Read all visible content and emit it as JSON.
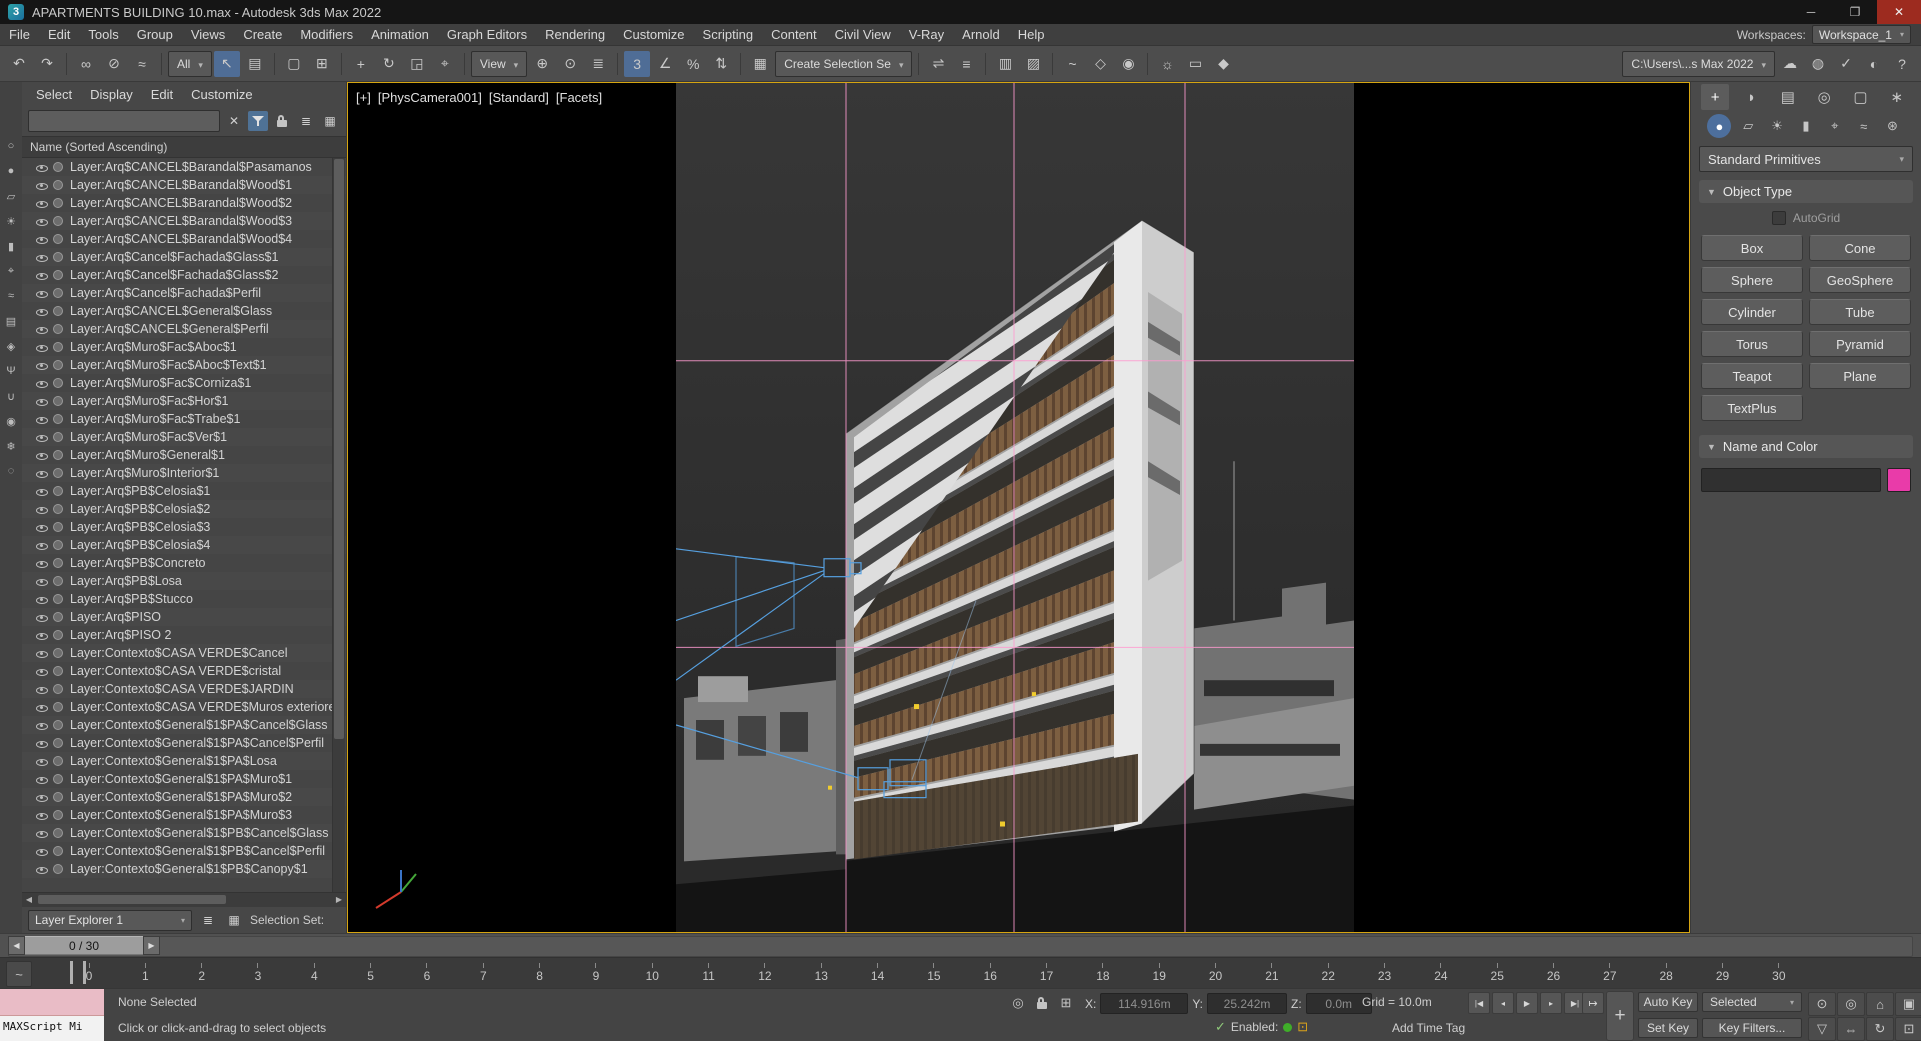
{
  "window": {
    "title": "APARTMENTS BUILDING 10.max - Autodesk 3ds Max 2022",
    "logo": "3",
    "controls": [
      {
        "name": "minimize-button",
        "glyph": "─"
      },
      {
        "name": "maximize-button",
        "glyph": "❐"
      },
      {
        "name": "close-button",
        "glyph": "✕"
      }
    ]
  },
  "menu": {
    "items": [
      "File",
      "Edit",
      "Tools",
      "Group",
      "Views",
      "Create",
      "Modifiers",
      "Animation",
      "Graph Editors",
      "Rendering",
      "Customize",
      "Scripting",
      "Content",
      "Civil View",
      "V-Ray",
      "Arnold",
      "Help"
    ],
    "workspaces_label": "Workspaces:",
    "workspace_value": "Workspace_1"
  },
  "toolbar": {
    "items": [
      {
        "t": "icon",
        "name": "undo-icon",
        "glyph": "↶"
      },
      {
        "t": "icon",
        "name": "redo-icon",
        "glyph": "↷"
      },
      {
        "t": "sep"
      },
      {
        "t": "icon",
        "name": "select-and-link-icon",
        "glyph": "∞"
      },
      {
        "t": "icon",
        "name": "unlink-selection-icon",
        "glyph": "⊘"
      },
      {
        "t": "icon",
        "name": "bind-to-space-warp-icon",
        "glyph": "≈"
      },
      {
        "t": "sep"
      },
      {
        "t": "dd",
        "name": "selection-filter-dropdown",
        "label": "All"
      },
      {
        "t": "icon",
        "name": "select-object-icon",
        "glyph": "↖",
        "active": true
      },
      {
        "t": "icon",
        "name": "select-by-name-icon",
        "glyph": "▤"
      },
      {
        "t": "sep"
      },
      {
        "t": "icon",
        "name": "rectangular-selection-region-icon",
        "glyph": "▢"
      },
      {
        "t": "icon",
        "name": "window-crossing-icon",
        "glyph": "⊞"
      },
      {
        "t": "sep"
      },
      {
        "t": "icon",
        "name": "select-and-move-icon",
        "glyph": "+"
      },
      {
        "t": "icon",
        "name": "select-and-rotate-icon",
        "glyph": "↻"
      },
      {
        "t": "icon",
        "name": "select-and-scale-icon",
        "glyph": "◲"
      },
      {
        "t": "icon",
        "name": "select-and-place-icon",
        "glyph": "⌖"
      },
      {
        "t": "sep"
      },
      {
        "t": "dd",
        "name": "reference-coordinate-dropdown",
        "label": "View"
      },
      {
        "t": "icon",
        "name": "use-pivot-point-center-icon",
        "glyph": "⊕"
      },
      {
        "t": "icon",
        "name": "select-and-manipulate-icon",
        "glyph": "⊙"
      },
      {
        "t": "icon",
        "name": "keyboard-shortcut-override-icon",
        "glyph": "≣"
      },
      {
        "t": "sep"
      },
      {
        "t": "icon",
        "name": "snaps-toggle-icon",
        "glyph": "3",
        "active": true
      },
      {
        "t": "icon",
        "name": "angle-snap-icon",
        "glyph": "∠"
      },
      {
        "t": "icon",
        "name": "percent-snap-icon",
        "glyph": "%"
      },
      {
        "t": "icon",
        "name": "spinner-snap-icon",
        "glyph": "⇅"
      },
      {
        "t": "sep"
      },
      {
        "t": "icon",
        "name": "edit-named-selection-sets-icon",
        "glyph": "▦"
      },
      {
        "t": "dd",
        "name": "named-selection-sets-dropdown",
        "label": "Create Selection Se"
      },
      {
        "t": "sep"
      },
      {
        "t": "icon",
        "name": "mirror-icon",
        "glyph": "⇌"
      },
      {
        "t": "icon",
        "name": "align-icon",
        "glyph": "≡"
      },
      {
        "t": "sep"
      },
      {
        "t": "icon",
        "name": "toggle-scene-explorer-icon",
        "glyph": "▥"
      },
      {
        "t": "icon",
        "name": "toggle-layer-explorer-icon",
        "glyph": "▨"
      },
      {
        "t": "sep"
      },
      {
        "t": "icon",
        "name": "curve-editor-icon",
        "glyph": "~"
      },
      {
        "t": "icon",
        "name": "schematic-view-icon",
        "glyph": "◇"
      },
      {
        "t": "icon",
        "name": "material-editor-icon",
        "glyph": "◉"
      },
      {
        "t": "sep"
      },
      {
        "t": "icon",
        "name": "render-setup-icon",
        "glyph": "☼"
      },
      {
        "t": "icon",
        "name": "rendered-frame-window-icon",
        "glyph": "▭"
      },
      {
        "t": "icon",
        "name": "render-production-icon",
        "glyph": "◆"
      },
      {
        "t": "spacer"
      },
      {
        "t": "dd",
        "name": "project-folder-field",
        "label": "C:\\Users\\...s Max 2022"
      },
      {
        "t": "icon",
        "name": "render-in-cloud-icon",
        "glyph": "☁"
      },
      {
        "t": "icon",
        "name": "autodesk-app-store-icon",
        "glyph": "◍"
      },
      {
        "t": "icon",
        "name": "scene-security-tools-icon",
        "glyph": "✓"
      },
      {
        "t": "icon",
        "name": "autodesk-account-icon",
        "glyph": "◐"
      },
      {
        "t": "icon",
        "name": "help-icon",
        "glyph": "?"
      }
    ]
  },
  "explorer": {
    "menus": [
      "Select",
      "Display",
      "Edit",
      "Customize"
    ],
    "search_value": "",
    "header": "Name (Sorted Ascending)",
    "side_icons": [
      {
        "name": "explorer-find-icon",
        "glyph": "○"
      },
      {
        "name": "display-geometry-icon",
        "glyph": "●"
      },
      {
        "name": "display-shapes-icon",
        "glyph": "▱"
      },
      {
        "name": "display-lights-icon",
        "glyph": "☀"
      },
      {
        "name": "display-cameras-icon",
        "glyph": "▮"
      },
      {
        "name": "display-helpers-icon",
        "glyph": "⌖"
      },
      {
        "name": "display-spacewarps-icon",
        "glyph": "≈"
      },
      {
        "name": "display-groups-icon",
        "glyph": "▤"
      },
      {
        "name": "display-xrefs-icon",
        "glyph": "◈"
      },
      {
        "name": "display-bones-icon",
        "glyph": "Ψ"
      },
      {
        "name": "display-containers-icon",
        "glyph": "∪"
      },
      {
        "name": "display-materials-icon",
        "glyph": "◉"
      },
      {
        "name": "display-frozen-icon",
        "glyph": "❄"
      },
      {
        "name": "display-hidden-icon",
        "glyph": "◌"
      }
    ],
    "layers": [
      "Layer:Arq$CANCEL$Barandal$Pasamanos",
      "Layer:Arq$CANCEL$Barandal$Wood$1",
      "Layer:Arq$CANCEL$Barandal$Wood$2",
      "Layer:Arq$CANCEL$Barandal$Wood$3",
      "Layer:Arq$CANCEL$Barandal$Wood$4",
      "Layer:Arq$Cancel$Fachada$Glass$1",
      "Layer:Arq$Cancel$Fachada$Glass$2",
      "Layer:Arq$Cancel$Fachada$Perfil",
      "Layer:Arq$CANCEL$General$Glass",
      "Layer:Arq$CANCEL$General$Perfil",
      "Layer:Arq$Muro$Fac$Aboc$1",
      "Layer:Arq$Muro$Fac$Aboc$Text$1",
      "Layer:Arq$Muro$Fac$Corniza$1",
      "Layer:Arq$Muro$Fac$Hor$1",
      "Layer:Arq$Muro$Fac$Trabe$1",
      "Layer:Arq$Muro$Fac$Ver$1",
      "Layer:Arq$Muro$General$1",
      "Layer:Arq$Muro$Interior$1",
      "Layer:Arq$PB$Celosia$1",
      "Layer:Arq$PB$Celosia$2",
      "Layer:Arq$PB$Celosia$3",
      "Layer:Arq$PB$Celosia$4",
      "Layer:Arq$PB$Concreto",
      "Layer:Arq$PB$Losa",
      "Layer:Arq$PB$Stucco",
      "Layer:Arq$PISO",
      "Layer:Arq$PISO 2",
      "Layer:Contexto$CASA VERDE$Cancel",
      "Layer:Contexto$CASA VERDE$cristal",
      "Layer:Contexto$CASA VERDE$JARDIN",
      "Layer:Contexto$CASA VERDE$Muros exteriores",
      "Layer:Contexto$General$1$PA$Cancel$Glass",
      "Layer:Contexto$General$1$PA$Cancel$Perfil",
      "Layer:Contexto$General$1$PA$Losa",
      "Layer:Contexto$General$1$PA$Muro$1",
      "Layer:Contexto$General$1$PA$Muro$2",
      "Layer:Contexto$General$1$PA$Muro$3",
      "Layer:Contexto$General$1$PB$Cancel$Glass",
      "Layer:Contexto$General$1$PB$Cancel$Perfil",
      "Layer:Contexto$General$1$PB$Canopy$1"
    ],
    "footer": {
      "explorer_name": "Layer Explorer 1",
      "selection_set_label": "Selection Set:"
    }
  },
  "viewport": {
    "labels": {
      "pov": "[+]",
      "camera": "[PhysCamera001]",
      "style": "[Standard]",
      "shading": "[Facets]"
    }
  },
  "command_panel": {
    "tabs": [
      {
        "name": "create-tab",
        "glyph": "+",
        "active": true
      },
      {
        "name": "modify-tab",
        "glyph": "◗"
      },
      {
        "name": "hierarchy-tab",
        "glyph": "▤"
      },
      {
        "name": "motion-tab",
        "glyph": "◎"
      },
      {
        "name": "display-tab",
        "glyph": "▢"
      },
      {
        "name": "utilities-tab",
        "glyph": "∗"
      }
    ],
    "categories": [
      {
        "name": "geometry-category-icon",
        "glyph": "●",
        "active": true
      },
      {
        "name": "shapes-category-icon",
        "glyph": "▱"
      },
      {
        "name": "lights-category-icon",
        "glyph": "☀"
      },
      {
        "name": "cameras-category-icon",
        "glyph": "▮"
      },
      {
        "name": "helpers-category-icon",
        "glyph": "⌖"
      },
      {
        "name": "spacewarps-category-icon",
        "glyph": "≈"
      },
      {
        "name": "systems-category-icon",
        "glyph": "⊛"
      }
    ],
    "subcategory": "Standard Primitives",
    "rollouts": {
      "object_type": "Object Type",
      "name_color": "Name and Color"
    },
    "autogrid_label": "AutoGrid",
    "buttons": [
      {
        "name": "box-button",
        "label": "Box"
      },
      {
        "name": "cone-button",
        "label": "Cone"
      },
      {
        "name": "sphere-button",
        "label": "Sphere"
      },
      {
        "name": "geosphere-button",
        "label": "GeoSphere"
      },
      {
        "name": "cylinder-button",
        "label": "Cylinder"
      },
      {
        "name": "tube-button",
        "label": "Tube"
      },
      {
        "name": "torus-button",
        "label": "Torus"
      },
      {
        "name": "pyramid-button",
        "label": "Pyramid"
      },
      {
        "name": "teapot-button",
        "label": "Teapot"
      },
      {
        "name": "plane-button",
        "label": "Plane"
      },
      {
        "name": "textplus-button",
        "label": "TextPlus"
      }
    ],
    "name_value": "",
    "object_color": "#e93ba9"
  },
  "timeline": {
    "slider_value": "0 / 30",
    "ticks": [
      "0",
      "1",
      "2",
      "3",
      "4",
      "5",
      "6",
      "7",
      "8",
      "9",
      "10",
      "11",
      "12",
      "13",
      "14",
      "15",
      "16",
      "17",
      "18",
      "19",
      "20",
      "21",
      "22",
      "23",
      "24",
      "25",
      "26",
      "27",
      "28",
      "29",
      "30"
    ]
  },
  "status": {
    "listener_text": "MAXScript Mi",
    "selection_status": "None Selected",
    "prompt": "Click or click-and-drag to select objects",
    "coords": {
      "x_label": "X:",
      "x": "114.916m",
      "y_label": "Y:",
      "y": "25.242m",
      "z_label": "Z:",
      "z": "0.0m"
    },
    "grid": "Grid = 10.0m",
    "security_label": "Enabled:",
    "add_time_tag": "Add Time Tag",
    "auto_key": "Auto Key",
    "set_key": "Set Key",
    "selected": "Selected",
    "key_filters": "Key Filters...",
    "playback": [
      {
        "name": "go-to-start-button",
        "glyph": "|◀"
      },
      {
        "name": "previous-frame-button",
        "glyph": "◂"
      },
      {
        "name": "play-button",
        "glyph": "▶"
      },
      {
        "name": "next-frame-button",
        "glyph": "▸"
      },
      {
        "name": "go-to-end-button",
        "glyph": "▶|"
      }
    ],
    "nav_row1": [
      {
        "name": "zoom-button",
        "glyph": "⊙"
      },
      {
        "name": "zoom-all-button",
        "glyph": "◎"
      },
      {
        "name": "zoom-extents-button",
        "glyph": "⌂"
      },
      {
        "name": "zoom-extents-all-button",
        "glyph": "▣"
      }
    ],
    "nav_row2": [
      {
        "name": "field-of-view-button",
        "glyph": "▽"
      },
      {
        "name": "pan-button",
        "glyph": "⇔"
      },
      {
        "name": "orbit-button",
        "glyph": "↻"
      },
      {
        "name": "maximize-viewport-button",
        "glyph": "⊡"
      }
    ]
  },
  "colors": {
    "accent_blue": "#4f6d96",
    "viewport_border": "#d6a511",
    "pink_line": "#ff9ad0",
    "camera_blue": "#56a0e0",
    "object_color": "#e93ba9"
  }
}
